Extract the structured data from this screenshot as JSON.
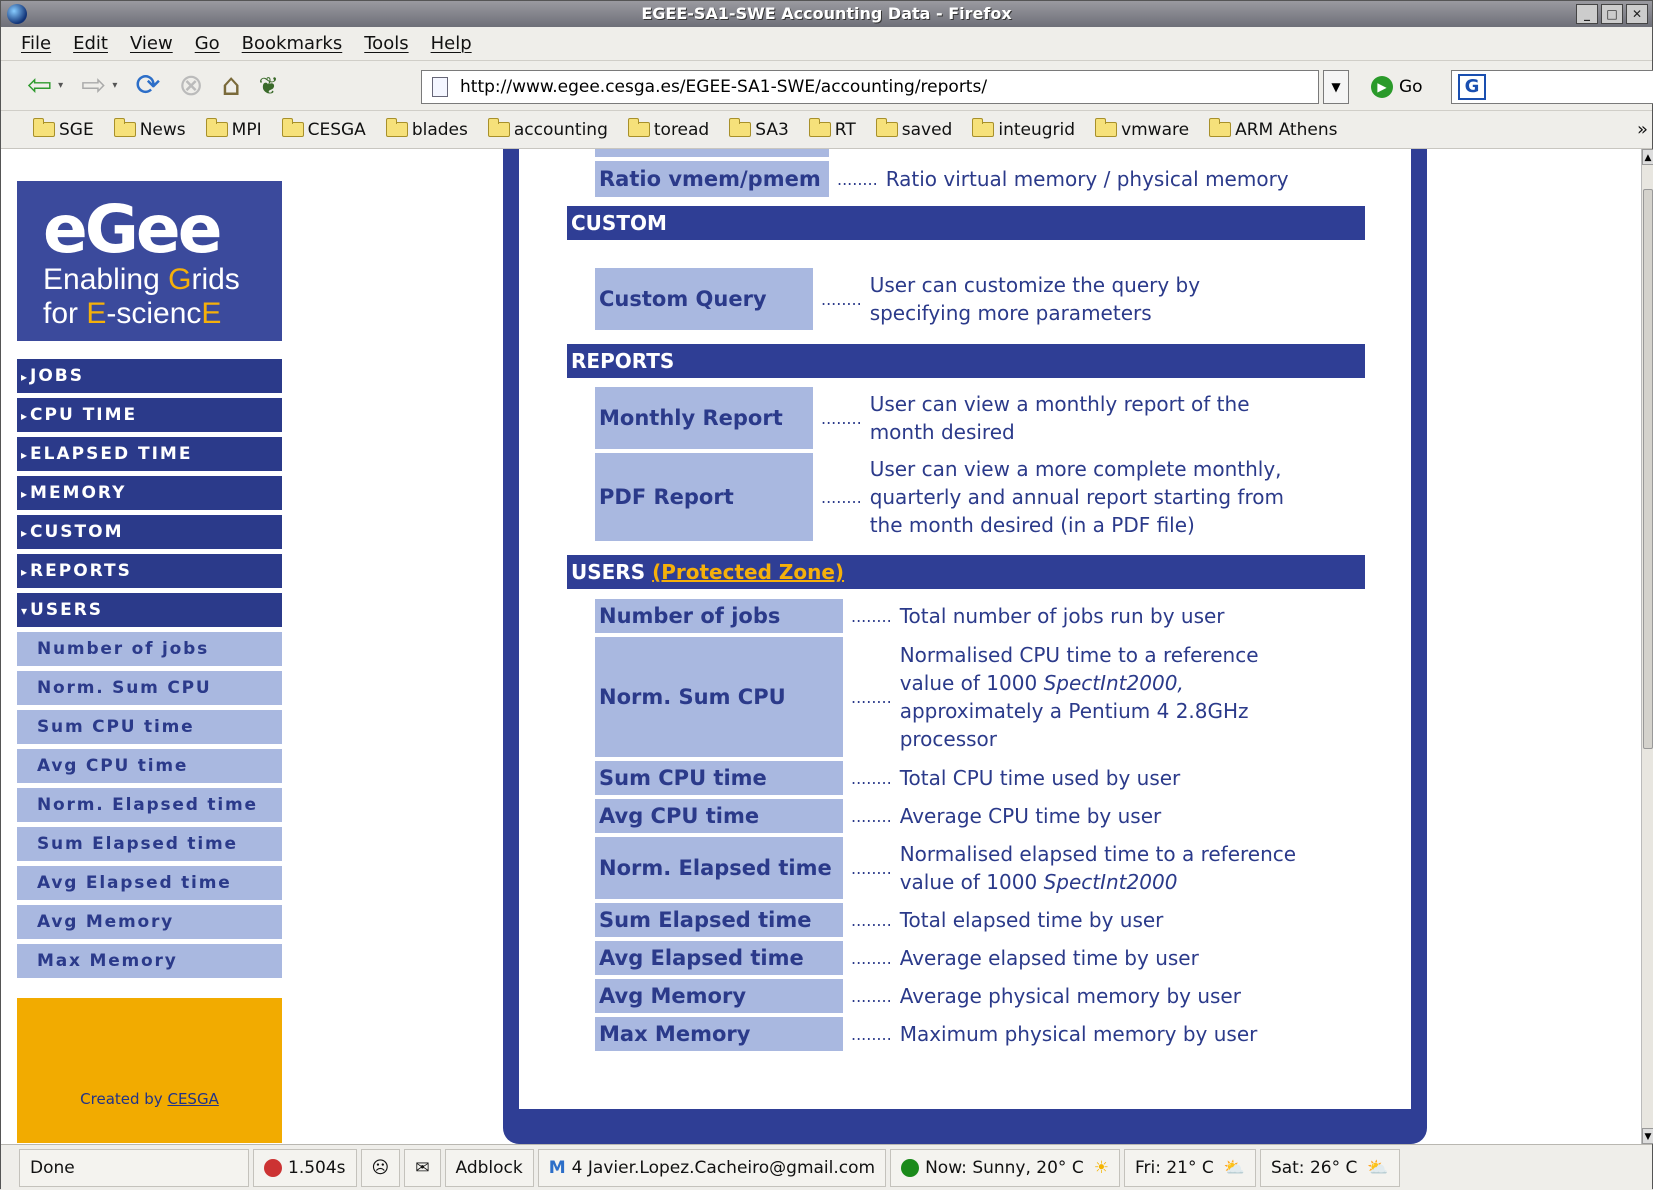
{
  "window": {
    "title": "EGEE-SA1-SWE Accounting Data - Firefox"
  },
  "menu": [
    "File",
    "Edit",
    "View",
    "Go",
    "Bookmarks",
    "Tools",
    "Help"
  ],
  "nav": {
    "url": "http://www.egee.cesga.es/EGEE-SA1-SWE/accounting/reports/",
    "go_label": "Go"
  },
  "bookmarks": [
    "SGE",
    "News",
    "MPI",
    "CESGA",
    "blades",
    "accounting",
    "toread",
    "SA3",
    "RT",
    "saved",
    "inteugrid",
    "vmware",
    "ARM Athens"
  ],
  "bookmarks_more": "»",
  "logo": {
    "main": "eGee",
    "line1a": "Enabling ",
    "line1b": "G",
    "line1c": "rids",
    "line2a": "for ",
    "line2b": "E",
    "line2c": "-scienc",
    "line2d": "E"
  },
  "sidebar": {
    "main": [
      "JOBS",
      "CPU TIME",
      "ELAPSED TIME",
      "MEMORY",
      "CUSTOM",
      "REPORTS",
      "USERS"
    ],
    "users_sub": [
      "Number of jobs",
      "Norm. Sum CPU",
      "Sum CPU time",
      "Avg CPU time",
      "Norm. Elapsed time",
      "Sum Elapsed time",
      "Avg Elapsed time",
      "Avg Memory",
      "Max Memory"
    ]
  },
  "created": {
    "prefix": "Created by ",
    "link": "CESGA"
  },
  "content": {
    "ratio": {
      "label": "Ratio vmem/pmem",
      "dots": "........",
      "desc": "Ratio virtual memory / physical memory"
    },
    "custom_header": "CUSTOM",
    "custom_query": {
      "label": "Custom Query",
      "dots": "........",
      "desc": "User can customize the query by specifying more parameters"
    },
    "reports_header": "REPORTS",
    "monthly": {
      "label": "Monthly Report",
      "dots": "........",
      "desc": "User can view a monthly report of the month desired"
    },
    "pdf": {
      "label": "PDF Report",
      "dots": "........",
      "desc": "User can view a more complete monthly, quarterly and annual report starting from the month desired (in a PDF file)"
    },
    "users_header": "USERS ",
    "users_link": "(Protected Zone)",
    "users": [
      {
        "label": "Number of jobs",
        "dots": "........",
        "desc": "Total number of jobs run by user"
      },
      {
        "label": "Norm. Sum CPU",
        "dots": "........",
        "desc": "Normalised CPU time to a reference value of 1000 ",
        "desc_em": "SpectInt2000,",
        "desc_tail": " approximately a Pentium 4 2.8GHz processor"
      },
      {
        "label": "Sum CPU time",
        "dots": "........",
        "desc": "Total CPU time used by user"
      },
      {
        "label": "Avg CPU time",
        "dots": "........",
        "desc": "Average CPU time by user"
      },
      {
        "label": "Norm. Elapsed time",
        "dots": "........",
        "desc": "Normalised elapsed time to a reference value of 1000 ",
        "desc_em": "SpectInt2000"
      },
      {
        "label": "Sum Elapsed time",
        "dots": "........",
        "desc": "Total elapsed time by user"
      },
      {
        "label": "Avg Elapsed time",
        "dots": "........",
        "desc": "Average elapsed time by user"
      },
      {
        "label": "Avg Memory",
        "dots": "........",
        "desc": "Average physical memory by user"
      },
      {
        "label": "Max Memory",
        "dots": "........",
        "desc": "Maximum physical memory by user"
      }
    ]
  },
  "status": {
    "done": "Done",
    "timer": "1.504s",
    "adblock": "Adblock",
    "gmail": "4 Javier.Lopez.Cacheiro@gmail.com",
    "now": "Now: Sunny, 20° C",
    "fri": "Fri: 21° C",
    "sat": "Sat: 26° C"
  }
}
